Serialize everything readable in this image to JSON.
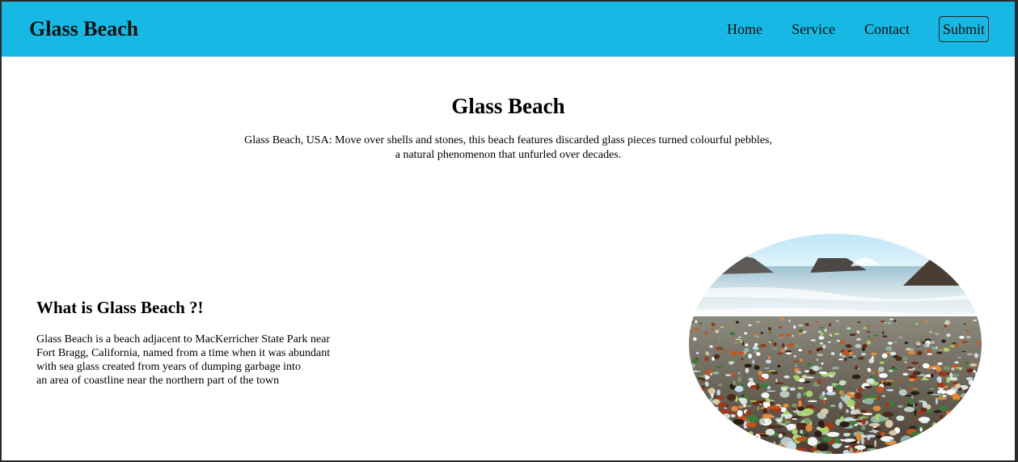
{
  "navbar": {
    "brand": "Glass Beach",
    "links": [
      {
        "label": "Home"
      },
      {
        "label": "Service"
      },
      {
        "label": "Contact"
      }
    ],
    "submit_label": "Submit",
    "background": "#17b9e4"
  },
  "hero": {
    "title": "Glass Beach",
    "description_lines": [
      "Glass Beach, USA: Move over shells and stones, this beach features discarded glass pieces turned colourful pebbles,",
      "a natural phenomenon that unfurled over decades."
    ]
  },
  "about": {
    "title": "What is Glass Beach ?!",
    "text_lines": [
      "Glass Beach is a beach adjacent to MacKerricher State Park near",
      "Fort Bragg, California, named from a time when it was abundant",
      "with sea glass created from years of dumping garbage into",
      "an area of coastline near the northern part of the town"
    ]
  },
  "image": {
    "subject": "beach-covered-with-sea-glass-photo"
  }
}
